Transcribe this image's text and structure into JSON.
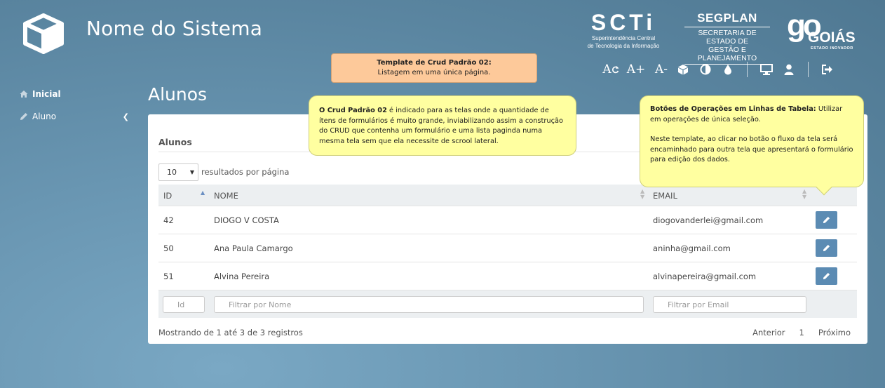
{
  "header": {
    "app_title": "Nome do Sistema",
    "brands": {
      "scti": {
        "name": "SCTi",
        "line1": "Superintendência Central",
        "line2": "de Tecnologia da Informação"
      },
      "segplan": {
        "name": "SEGPLAN",
        "line1": "SECRETARIA DE ESTADO DE",
        "line2": "GESTÃO E PLANEJAMENTO"
      },
      "goias": {
        "mark": "go",
        "name": "GOIÁS",
        "tagline": "ESTADO INOVADOR"
      }
    },
    "toolbar": {
      "font_reset": "A",
      "font_increase": "A+",
      "font_decrease": "A-"
    }
  },
  "sidebar": {
    "items": [
      {
        "label": "Inicial",
        "icon": "home-icon",
        "active": true
      },
      {
        "label": "Aluno",
        "icon": "pencil-icon",
        "active": false
      }
    ]
  },
  "main": {
    "page_title": "Alunos",
    "card_title": "Alunos",
    "page_length": {
      "value": "10",
      "label": "resultados por página"
    },
    "columns": {
      "id": "ID",
      "nome": "NOME",
      "email": "EMAIL"
    },
    "rows": [
      {
        "id": "42",
        "nome": "DIOGO V COSTA",
        "email": "diogovanderlei@gmail.com"
      },
      {
        "id": "50",
        "nome": "Ana Paula Camargo",
        "email": "aninha@gmail.com"
      },
      {
        "id": "51",
        "nome": "Alvina Pereira",
        "email": "alvinapereira@gmail.com"
      }
    ],
    "filters": {
      "id_placeholder": "Id",
      "nome_placeholder": "Filtrar por Nome",
      "email_placeholder": "Filtrar por Email"
    },
    "info": "Mostrando de 1 até 3 de 3 registros",
    "pager": {
      "prev": "Anterior",
      "page": "1",
      "next": "Próximo"
    }
  },
  "notes": {
    "template": {
      "title": "Template de Crud Padrão 02:",
      "body": "Listagem em uma única página."
    },
    "crud": {
      "bold": "O Crud Padrão 02",
      "body": " é indicado para as telas onde a quantidade de ítens de formulários é muito grande, inviabilizando assim a construção do CRUD que contenha um formulário e uma lista paginda numa mesma tela sem que ela necessite de scrool lateral."
    },
    "buttons": {
      "bold": "Botões de Operações em Linhas de  Tabela:",
      "body": " Utilizar em operações de única seleção.",
      "para2": "Neste template, ao clicar no botão o fluxo da tela será encaminhado para outra tela que apresentará o formulário para edição dos dados."
    }
  },
  "colors": {
    "accent_button": "#5b8bb3",
    "note_yellow": "#ffffa0",
    "note_orange": "#fdc99a"
  }
}
